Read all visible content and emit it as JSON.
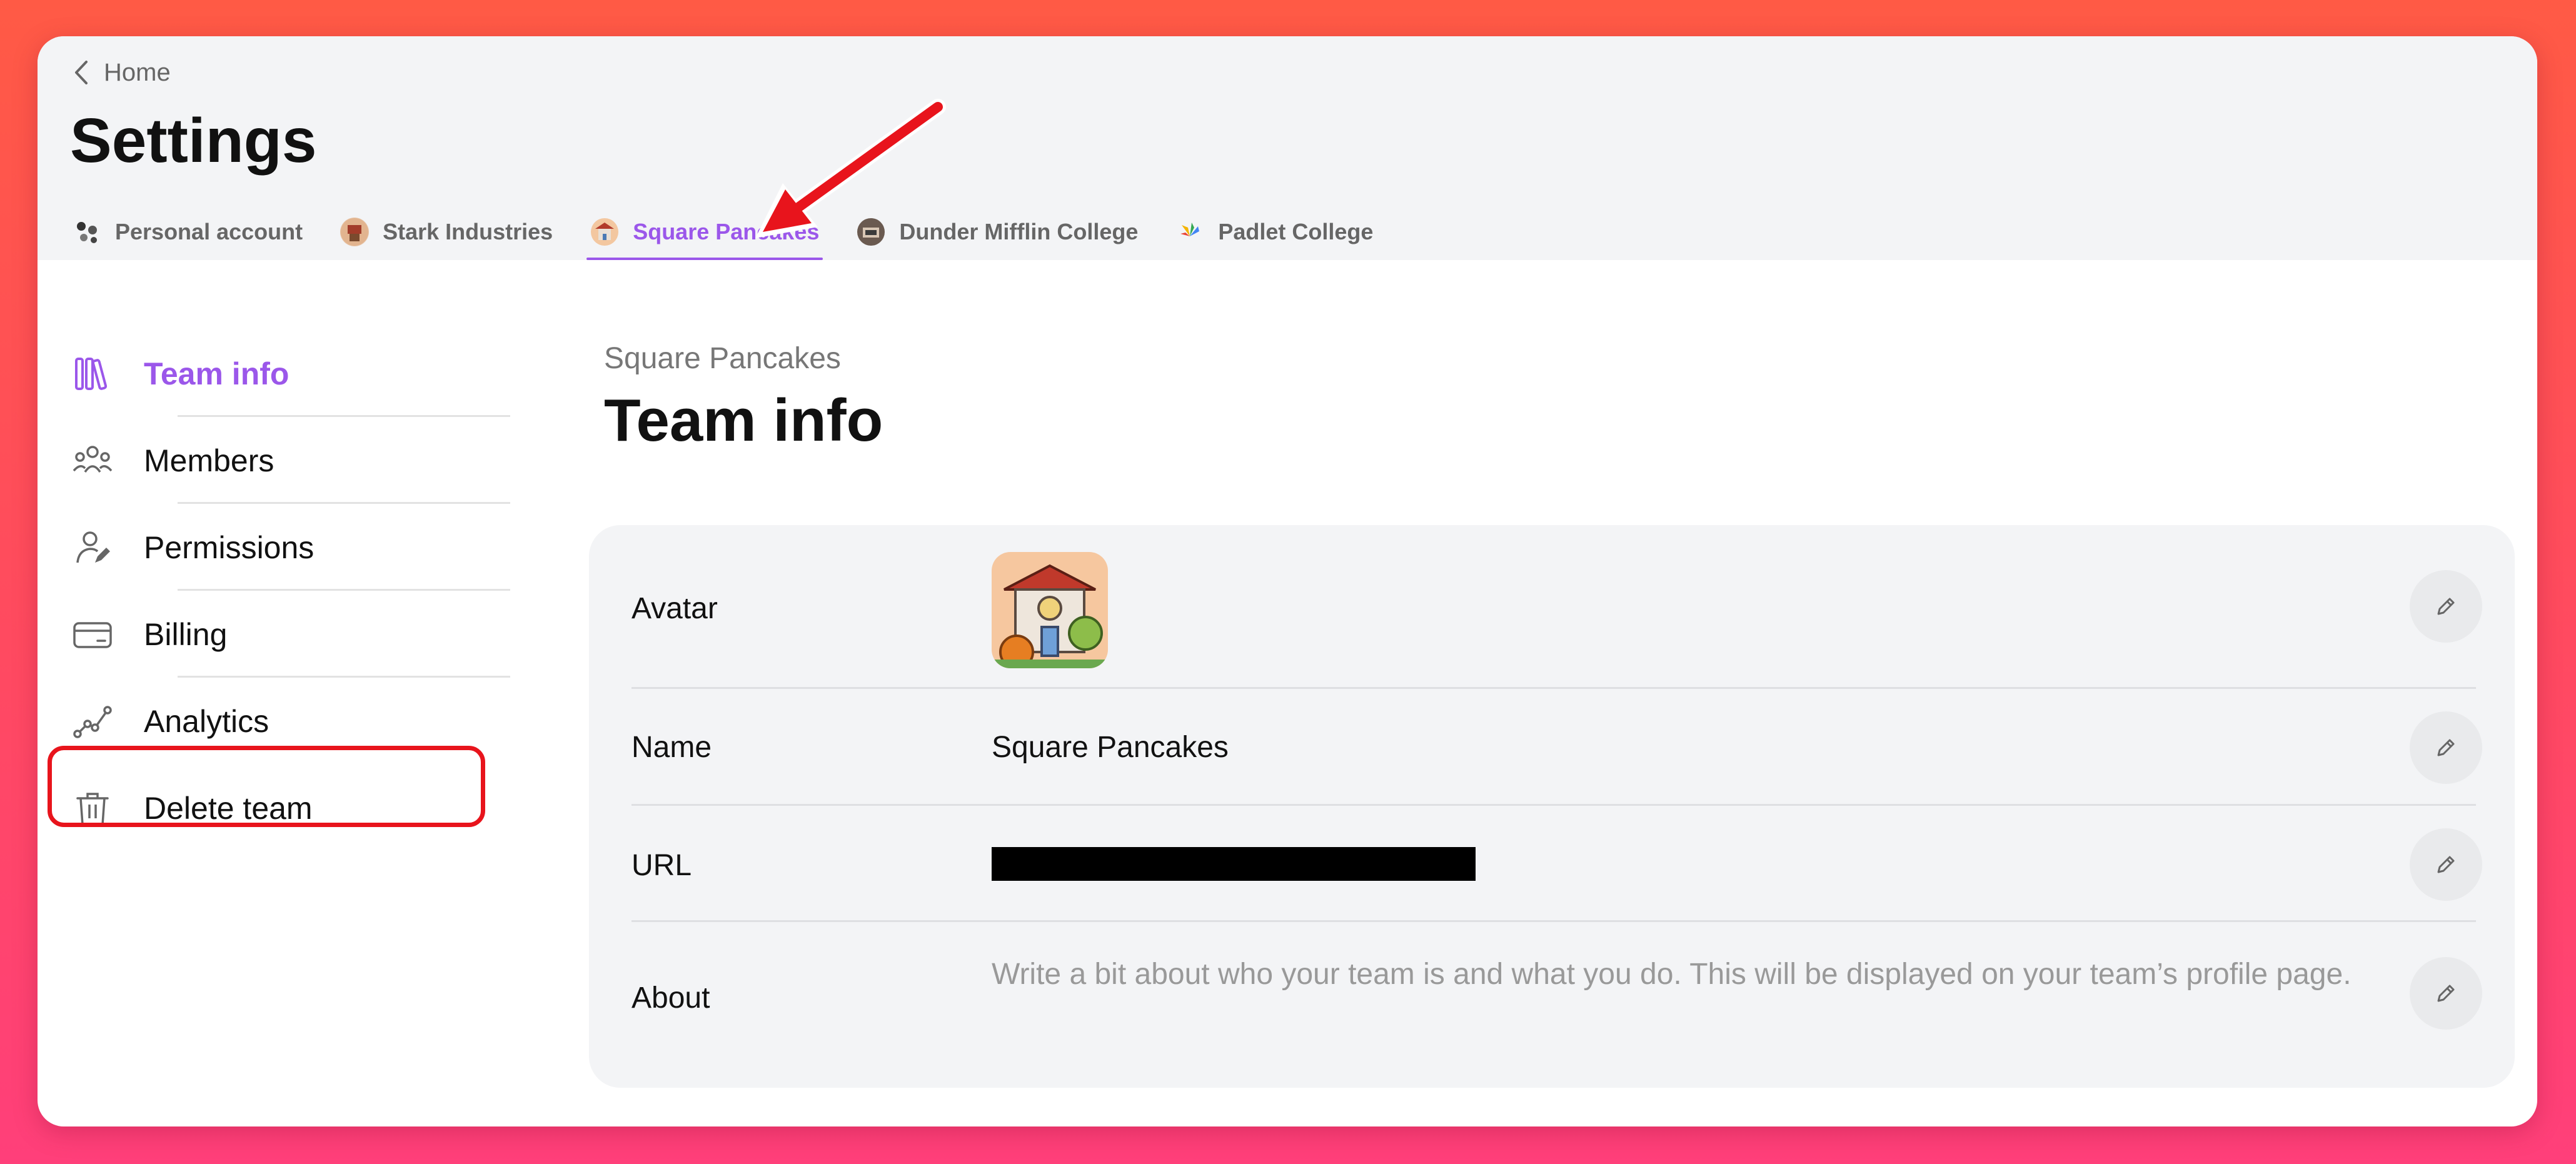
{
  "header": {
    "back_label": "Home",
    "title": "Settings",
    "tabs": [
      {
        "label": "Personal account",
        "icon": "personal-avatar-icon"
      },
      {
        "label": "Stark Industries",
        "icon": "stark-avatar-icon"
      },
      {
        "label": "Square Pancakes",
        "icon": "square-pancakes-avatar-icon",
        "active": true
      },
      {
        "label": "Dunder Mifflin College",
        "icon": "dunder-avatar-icon"
      },
      {
        "label": "Padlet College",
        "icon": "padlet-avatar-icon"
      }
    ]
  },
  "sidebar": {
    "items": [
      {
        "label": "Team info",
        "icon": "books-icon",
        "active": true
      },
      {
        "label": "Members",
        "icon": "people-icon"
      },
      {
        "label": "Permissions",
        "icon": "user-pencil-icon"
      },
      {
        "label": "Billing",
        "icon": "credit-card-icon"
      },
      {
        "label": "Analytics",
        "icon": "line-graph-icon"
      },
      {
        "label": "Delete team",
        "icon": "trash-icon"
      }
    ]
  },
  "main": {
    "breadcrumb": "Square Pancakes",
    "title": "Team info",
    "rows": {
      "avatar_label": "Avatar",
      "name_label": "Name",
      "name_value": "Square Pancakes",
      "url_label": "URL",
      "about_label": "About",
      "about_placeholder": "Write a bit about who your team is and what you do. This will be displayed on your team’s profile page."
    }
  },
  "colors": {
    "accent": "#9b57ea",
    "annotation_red": "#e8141c",
    "background_gradient_top": "#ff5a45",
    "background_gradient_bottom": "#ff3f7a"
  }
}
